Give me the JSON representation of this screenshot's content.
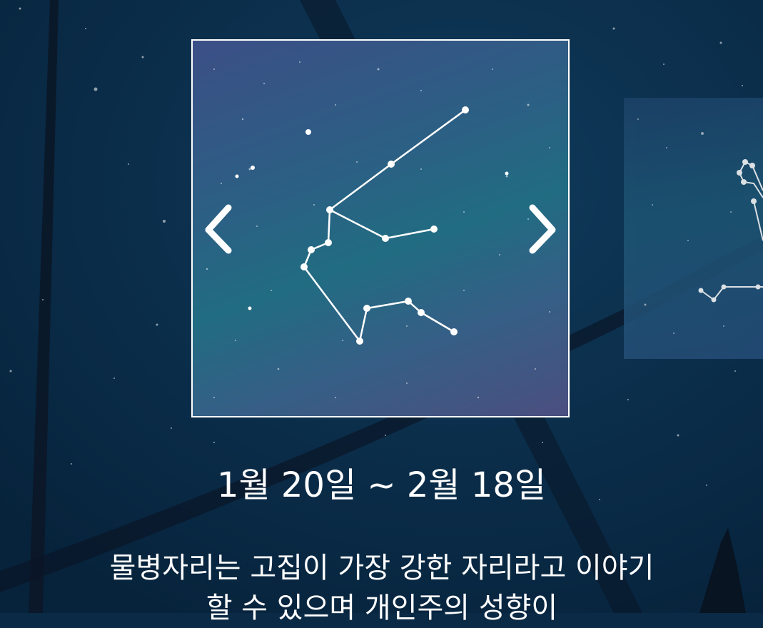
{
  "sign": {
    "date_range": "1월 20일 ~ 2월 18일",
    "description": "물병자리는 고집이 가장 강한 자리라고 이야기할 수 있으며 개인주의 성향이"
  },
  "carousel": {
    "prev_icon": "chevron-left-icon",
    "next_icon": "chevron-right-icon"
  },
  "colors": {
    "background": "#0b2a45",
    "card_border": "#ffffff",
    "text": "#ffffff"
  }
}
